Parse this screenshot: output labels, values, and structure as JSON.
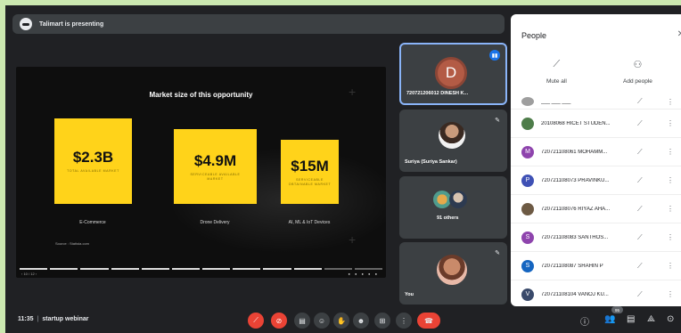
{
  "presenting": {
    "text": "Talimart is presenting"
  },
  "slide": {
    "title": "Market size of this opportunity",
    "markets": [
      {
        "value": "$2.3B",
        "sub": "TOTAL AVAILABLE MARKET",
        "label": "E-Commerce"
      },
      {
        "value": "$4.9M",
        "sub": "SERVICEABLE AVAILABLE MARKET",
        "label": "Drone Delivery"
      },
      {
        "value": "$15M",
        "sub": "SERVICEABLE OBTAINABLE MARKET",
        "label": "AI, ML & IoT Devices"
      }
    ],
    "source": "Source : Statista.com",
    "page": "‹ 10 / 12 ›"
  },
  "tiles": [
    {
      "initial": "D",
      "name": "720721206012 DINESH K..."
    },
    {
      "name": "Suriya (Suriya Sankar)"
    },
    {
      "name": "91 others"
    },
    {
      "name": "You"
    }
  ],
  "people": {
    "title": "People",
    "mute_all": "Mute all",
    "add_people": "Add people",
    "rows": [
      {
        "name": "___ ___ ___",
        "avatar": "",
        "color": "#9e9e9e"
      },
      {
        "name": "20108068 HICET STUDEN...",
        "avatar": "",
        "color": "#4e7d4a"
      },
      {
        "name": "720721108061 MOHAMM...",
        "avatar": "M",
        "color": "#8e44ad"
      },
      {
        "name": "720721108073 PRAVINKU...",
        "avatar": "P",
        "color": "#3f51b5"
      },
      {
        "name": "720721108076 RIYAZ AHA...",
        "avatar": "",
        "color": "#6d5a44"
      },
      {
        "name": "720721108083 SANTHOS...",
        "avatar": "S",
        "color": "#8e44ad"
      },
      {
        "name": "720721108087 SHAHIN P",
        "avatar": "S",
        "color": "#1565c0"
      },
      {
        "name": "720721108104 VANOJ KU...",
        "avatar": "V",
        "color": "#3a4a6b"
      }
    ]
  },
  "footer": {
    "time": "11:35",
    "meeting": "startup webinar",
    "participants_badge": "95"
  }
}
